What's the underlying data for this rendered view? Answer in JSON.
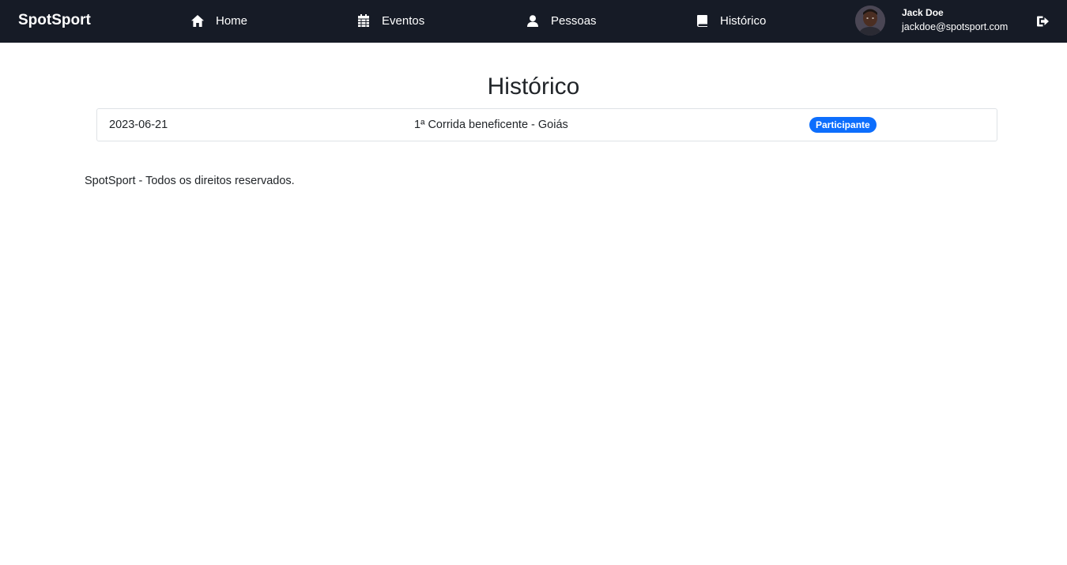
{
  "navbar": {
    "brand": "SpotSport",
    "items": [
      {
        "label": "Home",
        "icon": "home-icon"
      },
      {
        "label": "Eventos",
        "icon": "calendar-icon"
      },
      {
        "label": "Pessoas",
        "icon": "person-icon"
      },
      {
        "label": "Histórico",
        "icon": "book-icon"
      }
    ],
    "user": {
      "name": "Jack Doe",
      "email": "jackdoe@spotsport.com",
      "avatar_icon": "user-avatar"
    },
    "logout_icon": "logout-icon",
    "background_color": "#161b26"
  },
  "main": {
    "title": "Histórico",
    "history": [
      {
        "date": "2023-06-21",
        "event": "1ª Corrida beneficente - Goiás",
        "role": "Participante"
      }
    ],
    "badge_color": "#0d6efd"
  },
  "footer": {
    "text": "SpotSport - Todos os direitos reservados."
  }
}
